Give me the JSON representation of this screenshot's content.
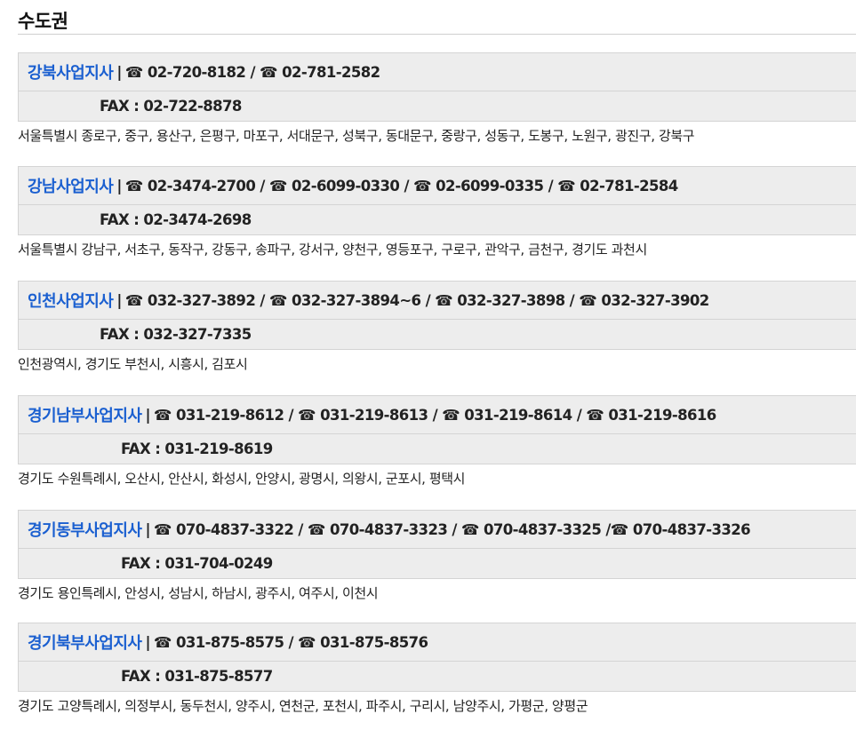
{
  "section": {
    "title": "수도권"
  },
  "offices": [
    {
      "name": "강북사업지사",
      "separator": "|",
      "phones": "☎ 02-720-8182 / ☎ 02-781-2582",
      "fax": "FAX : 02-722-8878",
      "area": "서울특별시 종로구, 중구, 용산구, 은평구, 마포구, 서대문구, 성북구, 동대문구, 중랑구, 성동구, 도봉구, 노원구, 광진구, 강북구"
    },
    {
      "name": "강남사업지사",
      "separator": "|",
      "phones": "☎ 02-3474-2700 / ☎ 02-6099-0330 / ☎ 02-6099-0335 / ☎ 02-781-2584",
      "fax": "FAX : 02-3474-2698",
      "area": "서울특별시 강남구, 서초구, 동작구, 강동구, 송파구, 강서구, 양천구, 영등포구, 구로구, 관악구, 금천구, 경기도 과천시"
    },
    {
      "name": "인천사업지사",
      "separator": "|",
      "phones": "☎ 032-327-3892 / ☎ 032-327-3894~6 / ☎ 032-327-3898 / ☎ 032-327-3902",
      "fax": "FAX : 032-327-7335",
      "area": "인천광역시, 경기도 부천시, 시흥시, 김포시"
    },
    {
      "name": "경기남부사업지사",
      "separator": "|",
      "phones": "☎ 031-219-8612 / ☎ 031-219-8613 / ☎ 031-219-8614 / ☎ 031-219-8616",
      "fax": "FAX : 031-219-8619",
      "area": "경기도 수원특례시, 오산시, 안산시, 화성시, 안양시, 광명시, 의왕시, 군포시, 평택시"
    },
    {
      "name": "경기동부사업지사",
      "separator": "|",
      "phones": "☎ 070-4837-3322 / ☎ 070-4837-3323 / ☎ 070-4837-3325 /☎ 070-4837-3326",
      "fax": "FAX : 031-704-0249",
      "area": "경기도 용인특례시, 안성시, 성남시, 하남시, 광주시, 여주시, 이천시"
    },
    {
      "name": "경기북부사업지사",
      "separator": "|",
      "phones": "☎ 031-875-8575 / ☎ 031-875-8576",
      "fax": "FAX : 031-875-8577",
      "area": "경기도 고양특례시, 의정부시, 동두천시, 양주시, 연천군, 포천시, 파주시, 구리시, 남양주시, 가평군, 양평군"
    }
  ]
}
